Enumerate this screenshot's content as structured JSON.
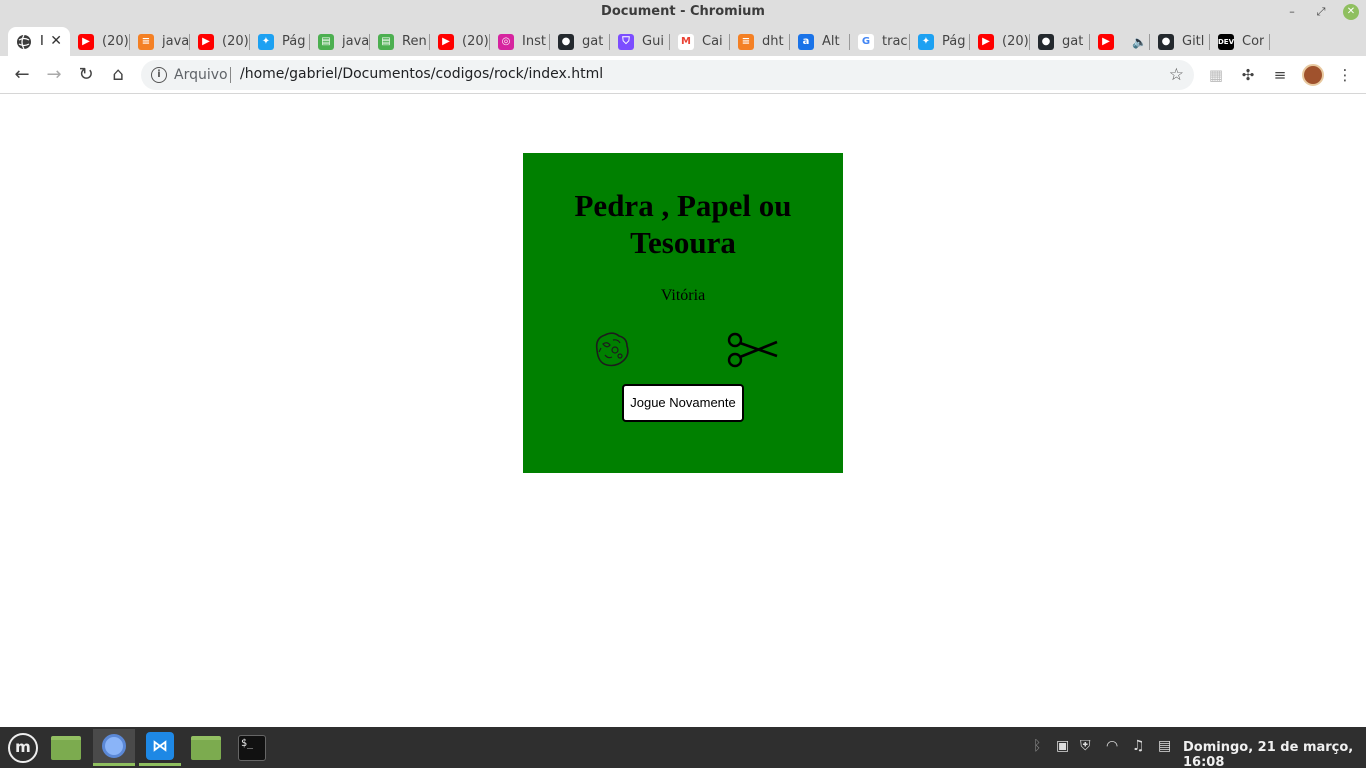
{
  "window": {
    "title": "Document - Chromium",
    "minimize": "–",
    "maximize": "⤢",
    "close": "✕"
  },
  "tabs": [
    {
      "label": "I",
      "icon": "globe-icon",
      "color": "#3c3c3c",
      "active": true
    },
    {
      "label": "(20)",
      "icon": "youtube-icon",
      "color": "#ff0000"
    },
    {
      "label": "java",
      "icon": "stackoverflow-icon",
      "color": "#f48024"
    },
    {
      "label": "(20)",
      "icon": "youtube-icon",
      "color": "#ff0000"
    },
    {
      "label": "Pág",
      "icon": "twitter-icon",
      "color": "#1da1f2"
    },
    {
      "label": "java",
      "icon": "stackedit-icon",
      "color": "#4caf50"
    },
    {
      "label": "Ren",
      "icon": "stackedit-icon",
      "color": "#4caf50"
    },
    {
      "label": "(20)",
      "icon": "youtube-icon",
      "color": "#ff0000"
    },
    {
      "label": "Inst",
      "icon": "instagram-icon",
      "color": "#d6249f"
    },
    {
      "label": "gat",
      "icon": "github-icon",
      "color": "#24292e"
    },
    {
      "label": "Gui",
      "icon": "shield-icon",
      "color": "#7c4dff"
    },
    {
      "label": "Cai",
      "icon": "gmail-icon",
      "color": "#ea4335"
    },
    {
      "label": "dht",
      "icon": "stackoverflow-icon",
      "color": "#f48024"
    },
    {
      "label": "Alt",
      "icon": "font-icon",
      "color": "#1a73e8"
    },
    {
      "label": "trac",
      "icon": "google-icon",
      "color": "#4285f4"
    },
    {
      "label": "Pág",
      "icon": "twitter-icon",
      "color": "#1da1f2"
    },
    {
      "label": "(20)",
      "icon": "youtube-icon",
      "color": "#ff0000"
    },
    {
      "label": "gat",
      "icon": "github-icon",
      "color": "#24292e"
    },
    {
      "label": "",
      "icon": "youtube-icon",
      "color": "#ff0000"
    },
    {
      "label": "Gitl",
      "icon": "github-icon",
      "color": "#24292e"
    },
    {
      "label": "Cor",
      "icon": "dev-icon",
      "color": "#000000"
    }
  ],
  "toolbar": {
    "scheme_label": "Arquivo",
    "url": "/home/gabriel/Documentos/codigos/rock/index.html"
  },
  "page": {
    "heading": "Pedra , Papel ou Tesoura",
    "result": "Vitória",
    "player_choice": "rock-icon",
    "computer_choice": "scissors-icon",
    "replay_label": "Jogue Novamente",
    "background": "#008000"
  },
  "taskbar": {
    "clock": "Domingo, 21 de março, 16:08"
  }
}
